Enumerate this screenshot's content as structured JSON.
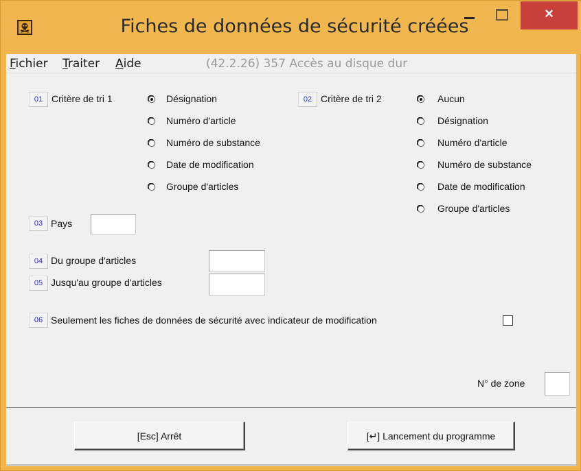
{
  "window": {
    "title": "Fiches de données de sécurité créées",
    "app_icon": "skull-hazard-icon",
    "close_label": "×",
    "colors": {
      "frame": "#f1b64d",
      "close": "#c7413a",
      "client": "#f0f0f0",
      "number_button_text": "#2b2bd0"
    }
  },
  "menubar": {
    "items": [
      {
        "label": "Fichier",
        "accel": "F"
      },
      {
        "label": "Traiter",
        "accel": "T"
      },
      {
        "label": "Aide",
        "accel": "A"
      }
    ],
    "info": "(42.2.26) 357 Accès au disque dur"
  },
  "form": {
    "sort1": {
      "number": "01",
      "label": "Critère de tri 1",
      "options": [
        "Désignation",
        "Numéro d'article",
        "Numéro de substance",
        "Date de modification",
        "Groupe d'articles"
      ],
      "selected": 0
    },
    "sort2": {
      "number": "02",
      "label": "Critère de tri 2",
      "options": [
        "Aucun",
        "Désignation",
        "Numéro d'article",
        "Numéro de substance",
        "Date de modification",
        "Groupe d'articles"
      ],
      "selected": 0
    },
    "country": {
      "number": "03",
      "label": "Pays",
      "value": ""
    },
    "group_from": {
      "number": "04",
      "label": "Du groupe d'articles",
      "value": ""
    },
    "group_to": {
      "number": "05",
      "label": "Jusqu'au groupe d'articles",
      "value": ""
    },
    "only_modified": {
      "number": "06",
      "label": "Seulement les fiches de données de sécurité avec indicateur de modification",
      "checked": false
    },
    "zone": {
      "label": "N° de zone",
      "value": ""
    }
  },
  "buttons": {
    "stop": "[Esc] Arrêt",
    "start": "[↵] Lancement du programme"
  }
}
